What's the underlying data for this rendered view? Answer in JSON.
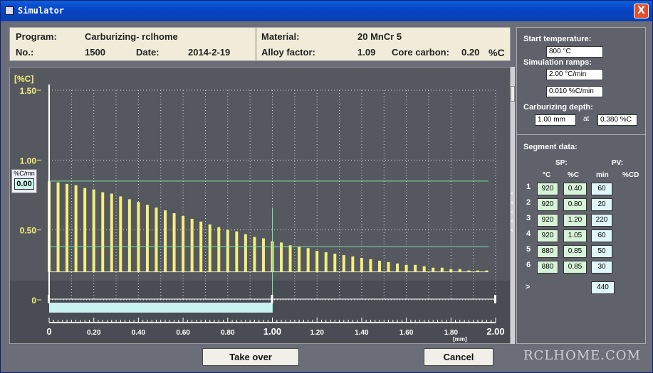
{
  "window": {
    "title": "Simulator",
    "close_label": "X"
  },
  "header": {
    "program_label": "Program:",
    "program_value": "Carburizing- rclhome",
    "no_label": "No.:",
    "no_value": "1500",
    "date_label": "Date:",
    "date_value": "2014-2-19",
    "material_label": "Material:",
    "material_value": "20 MnCr 5",
    "alloy_label": "Alloy factor:",
    "alloy_value": "1.09",
    "core_label": "Core carbon:",
    "core_value": "0.20",
    "core_unit": "%C"
  },
  "rate_box": {
    "label": "%C/mn",
    "value": "0.00"
  },
  "side": {
    "start_temp_label": "Start temperature:",
    "start_temp_value": "800 °C",
    "ramps_label": "Simulation ramps:",
    "ramp1": "2.00 °C/min",
    "ramp2": "0.010 %C/min",
    "depth_label": "Carburizing depth:",
    "depth_value": "1.00 mm",
    "at_label": "at",
    "depth_carbon": "0.380 %C",
    "segment_label": "Segment data:",
    "sp_label": "SP:",
    "pv_label": "PV:",
    "col_c": "°C",
    "col_pc": "%C",
    "col_min": "min",
    "col_cd": "%CD",
    "segments": [
      {
        "n": "1",
        "t": "920",
        "c": "0.40",
        "min": "60"
      },
      {
        "n": "2",
        "t": "920",
        "c": "0.80",
        "min": "20"
      },
      {
        "n": "3",
        "t": "920",
        "c": "1.20",
        "min": "220"
      },
      {
        "n": "4",
        "t": "920",
        "c": "1.05",
        "min": "60"
      },
      {
        "n": "5",
        "t": "880",
        "c": "0.85",
        "min": "50"
      },
      {
        "n": "6",
        "t": "880",
        "c": "0.85",
        "min": "30"
      }
    ],
    "total_label": ">",
    "total_value": "440"
  },
  "buttons": {
    "take_over": "Take over",
    "cancel": "Cancel"
  },
  "watermark": "RCLHOME.COM",
  "colors": {
    "bar": "#f3f07a",
    "grid": "#d8d8d8",
    "guide": "#7be3a8",
    "cyan": "#c8f3f0",
    "axis_label": "#f3f07a"
  },
  "chart_data": {
    "type": "bar",
    "ylabel": "[%C]",
    "xlabel": "[mm]",
    "yticks": [
      "1.50",
      "1.00",
      "0.50",
      "0"
    ],
    "ytick_values": [
      1.5,
      1.0,
      0.5,
      0
    ],
    "xticks": [
      "0",
      "0.20",
      "0.40",
      "0.60",
      "0.80",
      "1.00",
      "1.20",
      "1.40",
      "1.60",
      "1.80",
      "2.00"
    ],
    "xtick_values": [
      0,
      0.2,
      0.4,
      0.6,
      0.8,
      1.0,
      1.2,
      1.4,
      1.6,
      1.8,
      2.0
    ],
    "xlim": [
      0,
      2.0
    ],
    "ylim": [
      0,
      1.5
    ],
    "x": [
      0.0,
      0.04,
      0.08,
      0.12,
      0.16,
      0.2,
      0.24,
      0.28,
      0.32,
      0.36,
      0.4,
      0.44,
      0.48,
      0.52,
      0.56,
      0.6,
      0.64,
      0.68,
      0.72,
      0.76,
      0.8,
      0.84,
      0.88,
      0.92,
      0.96,
      1.0,
      1.04,
      1.08,
      1.12,
      1.16,
      1.2,
      1.24,
      1.28,
      1.32,
      1.36,
      1.4,
      1.44,
      1.48,
      1.52,
      1.56,
      1.6,
      1.64,
      1.68,
      1.72,
      1.76,
      1.8,
      1.84,
      1.88,
      1.92,
      1.96,
      2.0
    ],
    "values": [
      0.85,
      0.84,
      0.83,
      0.82,
      0.8,
      0.79,
      0.77,
      0.76,
      0.74,
      0.72,
      0.7,
      0.68,
      0.66,
      0.64,
      0.62,
      0.6,
      0.58,
      0.56,
      0.54,
      0.52,
      0.5,
      0.49,
      0.47,
      0.45,
      0.44,
      0.42,
      0.41,
      0.39,
      0.38,
      0.37,
      0.35,
      0.34,
      0.33,
      0.32,
      0.31,
      0.3,
      0.29,
      0.28,
      0.27,
      0.26,
      0.25,
      0.25,
      0.24,
      0.23,
      0.23,
      0.22,
      0.22,
      0.21,
      0.21,
      0.21,
      0.2
    ],
    "baseline": 0.2,
    "ref_y1": 0.85,
    "ref_y2": 0.38,
    "ref_x": 1.0,
    "grid": true
  }
}
